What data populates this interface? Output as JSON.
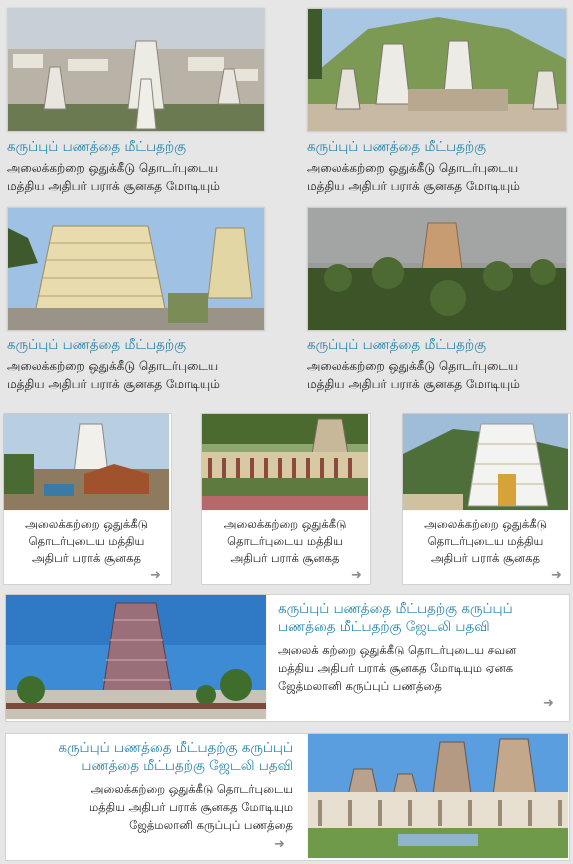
{
  "colors": {
    "link": "#1d7fa6",
    "text": "#111111",
    "background": "#e6e6e6",
    "arrow": "#8c8c8c"
  },
  "grid_cards": [
    {
      "title": "கருப்புப் பணத்தை மீட்பதற்கு",
      "line1": "அலைக்கற்றை ஒதுக்கீடு தொடர்புடைய",
      "line2": "மத்திய  அதிபர் பராக் சூனகத மோடியும்"
    },
    {
      "title": "கருப்புப் பணத்தை மீட்பதற்கு",
      "line1": "அலைக்கற்றை ஒதுக்கீடு தொடர்புடைய",
      "line2": "மத்திய  அதிபர் பராக் சூனகத மோடியும்"
    },
    {
      "title": "கருப்புப் பணத்தை மீட்பதற்கு",
      "line1": "அலைக்கற்றை ஒதுக்கீடு தொடர்புடைய",
      "line2": "மத்திய  அதிபர் பராக் சூனகத மோடியும்"
    },
    {
      "title": "கருப்புப் பணத்தை மீட்பதற்கு",
      "line1": "அலைக்கற்றை ஒதுக்கீடு தொடர்புடைய",
      "line2": "மத்திய  அதிபர் பராக் சூனகத மோடியும்"
    }
  ],
  "small_cards": [
    {
      "line1": "அலைக்கற்றை ஒதுக்கீடு",
      "line2": "தொடர்புடைய மத்திய",
      "line3": "அதிபர் பராக் சூனகத"
    },
    {
      "line1": "அலைக்கற்றை ஒதுக்கீடு",
      "line2": "தொடர்புடைய மத்திய",
      "line3": "அதிபர் பராக் சூனகத"
    },
    {
      "line1": "அலைக்கற்றை ஒதுக்கீடு",
      "line2": "தொடர்புடைய மத்திய",
      "line3": "அதிபர் பராக் சூனகத"
    }
  ],
  "feature_a": {
    "title_line1": "கருப்புப் பணத்தை மீட்பதற்கு கருப்புப்",
    "title_line2": "பணத்தை மீட்பதற்கு ஜேடலி பதவி",
    "line1": "அலைக் கற்றை ஒதுக்கீடு தொடர்புடைய சவன",
    "line2": "மத்திய  அதிபர் பராக் சூனகத மோடியும ஏனக",
    "line3": "ஜேத்மலானி கருப்புப் பணத்தை"
  },
  "feature_b": {
    "title_line1": "கருப்புப் பணத்தை மீட்பதற்கு கருப்புப்",
    "title_line2": "பணத்தை மீட்பதற்கு ஜேடலி பதவி",
    "line1": "அலைக்கற்றை ஒதுக்கீடு தொடர்புடைய",
    "line2": "மத்திய  அதிபர் பராக் சூனகத மோடியும",
    "line3": "ஜேத்மலானி கருப்புப் பணத்தை"
  },
  "icons": {
    "more": "arrow-right-icon"
  }
}
